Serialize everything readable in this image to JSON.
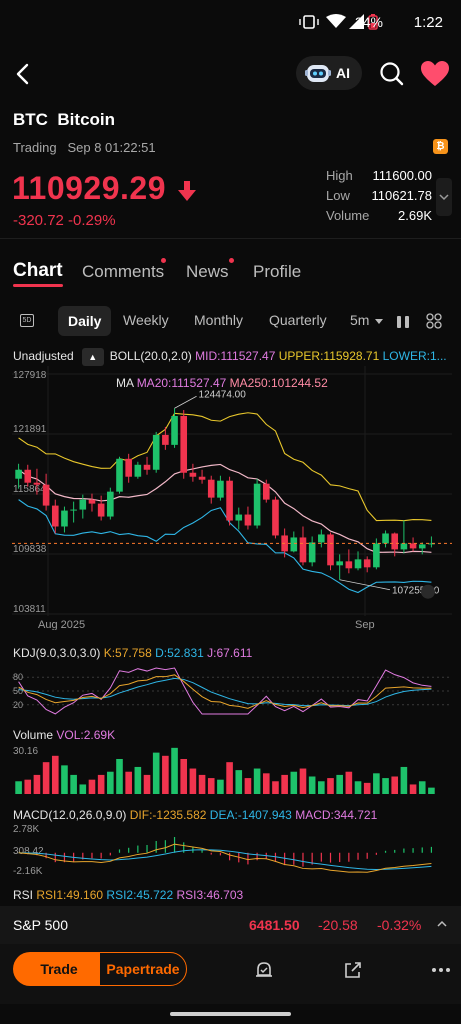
{
  "status_bar": {
    "battery": "34%",
    "time": "1:22"
  },
  "nav": {
    "ai_label": "AI"
  },
  "header": {
    "symbol": "BTC",
    "name": "Bitcoin",
    "status": "Trading",
    "timestamp": "Sep 8 01:22:51",
    "price": "110929.29",
    "change": "-320.72",
    "change_pct": "-0.29%",
    "coin_badge": "₿",
    "stats": [
      {
        "label": "High",
        "value": "111600.00"
      },
      {
        "label": "Low",
        "value": "110621.78"
      },
      {
        "label": "Volume",
        "value": "2.69K"
      }
    ]
  },
  "tabs": [
    {
      "label": "Chart",
      "active": true,
      "dot": false
    },
    {
      "label": "Comments",
      "active": false,
      "dot": true
    },
    {
      "label": "News",
      "active": false,
      "dot": true
    },
    {
      "label": "Profile",
      "active": false,
      "dot": false
    }
  ],
  "periods": {
    "icon_5d": "5D",
    "daily": "Daily",
    "weekly": "Weekly",
    "monthly": "Monthly",
    "quarterly": "Quarterly",
    "interval": "5m"
  },
  "indicators": {
    "adjust": "Unadjusted",
    "boll_name": "BOLL(20.0,2.0)",
    "boll_mid": "MID:111527.47",
    "boll_upper": "UPPER:115928.71",
    "boll_lower": "LOWER:1...",
    "ma_name": "MA",
    "ma20": "MA20:111527.47",
    "ma250": "MA250:101244.52",
    "kdj_name": "KDJ(9.0,3.0,3.0)",
    "kdj_k": "K:57.758",
    "kdj_d": "D:52.831",
    "kdj_j": "J:67.611",
    "vol_name": "Volume",
    "vol_value": "VOL:2.69K",
    "macd_name": "MACD(12.0,26.0,9.0)",
    "macd_dif": "DIF:-1235.582",
    "macd_dea": "DEA:-1407.943",
    "macd_val": "MACD:344.721",
    "rsi_name": "RSI",
    "rsi1": "RSI1:49.160",
    "rsi2": "RSI2:45.722",
    "rsi3": "RSI3:46.703"
  },
  "chart_data": {
    "type": "candlestick",
    "y_ticks": [
      "127918",
      "121891",
      "115864",
      "109838",
      "103811"
    ],
    "x_labels": [
      "Aug 2025",
      "Sep"
    ],
    "annotations": {
      "high": "124474.00",
      "low": "107255.00"
    },
    "ylim": [
      103811,
      127918
    ],
    "candles": [
      [
        117400,
        118900,
        116400,
        118300
      ],
      [
        118300,
        118800,
        116600,
        117000
      ],
      [
        117000,
        118400,
        115800,
        116800
      ],
      [
        116800,
        117900,
        114200,
        114700
      ],
      [
        114700,
        115300,
        111900,
        112600
      ],
      [
        112600,
        114600,
        112000,
        114200
      ],
      [
        114200,
        115100,
        113000,
        114300
      ],
      [
        114300,
        115800,
        113400,
        115300
      ],
      [
        115300,
        115900,
        114100,
        114900
      ],
      [
        114900,
        115700,
        113200,
        113600
      ],
      [
        113600,
        116500,
        113300,
        116100
      ],
      [
        116100,
        119600,
        115900,
        119400
      ],
      [
        119400,
        119900,
        117000,
        117600
      ],
      [
        117600,
        119100,
        117400,
        118800
      ],
      [
        118800,
        119600,
        117800,
        118300
      ],
      [
        118300,
        122100,
        118000,
        121800
      ],
      [
        121800,
        122600,
        120300,
        120800
      ],
      [
        120800,
        124474,
        120500,
        123700
      ],
      [
        123700,
        124300,
        117400,
        118000
      ],
      [
        118000,
        118900,
        117100,
        117600
      ],
      [
        117600,
        118300,
        116900,
        117300
      ],
      [
        117300,
        117700,
        114900,
        115500
      ],
      [
        115500,
        117700,
        115200,
        117200
      ],
      [
        117200,
        117600,
        112700,
        113200
      ],
      [
        113200,
        114500,
        112300,
        113800
      ],
      [
        113800,
        114600,
        112300,
        112700
      ],
      [
        112700,
        117400,
        112400,
        116900
      ],
      [
        116900,
        117300,
        115000,
        115300
      ],
      [
        115300,
        115600,
        111400,
        111700
      ],
      [
        111700,
        112400,
        109500,
        110100
      ],
      [
        110100,
        112100,
        110000,
        111500
      ],
      [
        111500,
        112600,
        108700,
        109000
      ],
      [
        109000,
        111600,
        108600,
        111000
      ],
      [
        111000,
        112300,
        110500,
        111800
      ],
      [
        111800,
        112000,
        108200,
        108700
      ],
      [
        108700,
        109800,
        107255,
        109100
      ],
      [
        109100,
        110300,
        107900,
        108400
      ],
      [
        108400,
        110100,
        108200,
        109300
      ],
      [
        109300,
        109600,
        108000,
        108500
      ],
      [
        108500,
        111400,
        108300,
        110900
      ],
      [
        110900,
        112200,
        110500,
        111900
      ],
      [
        111900,
        112000,
        109600,
        110300
      ],
      [
        110300,
        113200,
        109900,
        110900
      ],
      [
        110900,
        111500,
        110100,
        110400
      ],
      [
        110400,
        111000,
        109800,
        110800
      ],
      [
        110800,
        111600,
        110500,
        110900
      ]
    ],
    "volume_ylabel": "30.16",
    "volumes": [
      8,
      9,
      12,
      20,
      24,
      18,
      12,
      6,
      9,
      12,
      14,
      22,
      14,
      17,
      12,
      26,
      24,
      29,
      22,
      16,
      12,
      10,
      9,
      20,
      15,
      10,
      16,
      13,
      8,
      12,
      14,
      16,
      11,
      8,
      10,
      12,
      14,
      8,
      7,
      13,
      10,
      11,
      17,
      6,
      8,
      4
    ],
    "macd_ylabels": [
      "2.78K",
      "308.42",
      "-2.16K"
    ]
  },
  "ticker": {
    "name": "S&P 500",
    "price": "6481.50",
    "change": "-20.58",
    "pct": "-0.32%"
  },
  "bottom": {
    "trade": "Trade",
    "paper": "Papertrade"
  }
}
